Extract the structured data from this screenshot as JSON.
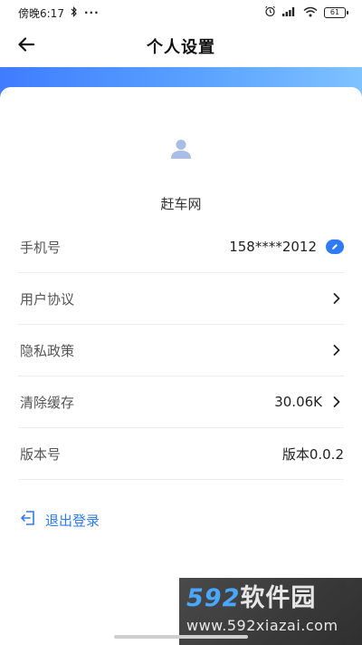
{
  "status_bar": {
    "time": "傍晚6:17",
    "dots": "···",
    "battery": "61"
  },
  "nav": {
    "title": "个人设置"
  },
  "profile": {
    "nickname": "赶车网"
  },
  "rows": [
    {
      "label": "手机号",
      "value": "158****2012"
    },
    {
      "label": "用户协议",
      "value": ""
    },
    {
      "label": "隐私政策",
      "value": ""
    },
    {
      "label": "清除缓存",
      "value": "30.06K"
    },
    {
      "label": "版本号",
      "value": "版本0.0.2"
    }
  ],
  "logout": {
    "label": "退出登录"
  },
  "watermark": {
    "brand_num": "592",
    "brand_text": "软件园",
    "url": "www.592xiazai.com"
  },
  "colors": {
    "accent": "#2f7bf6",
    "band_start": "#3f7cff",
    "band_end": "#7fc2ff"
  }
}
